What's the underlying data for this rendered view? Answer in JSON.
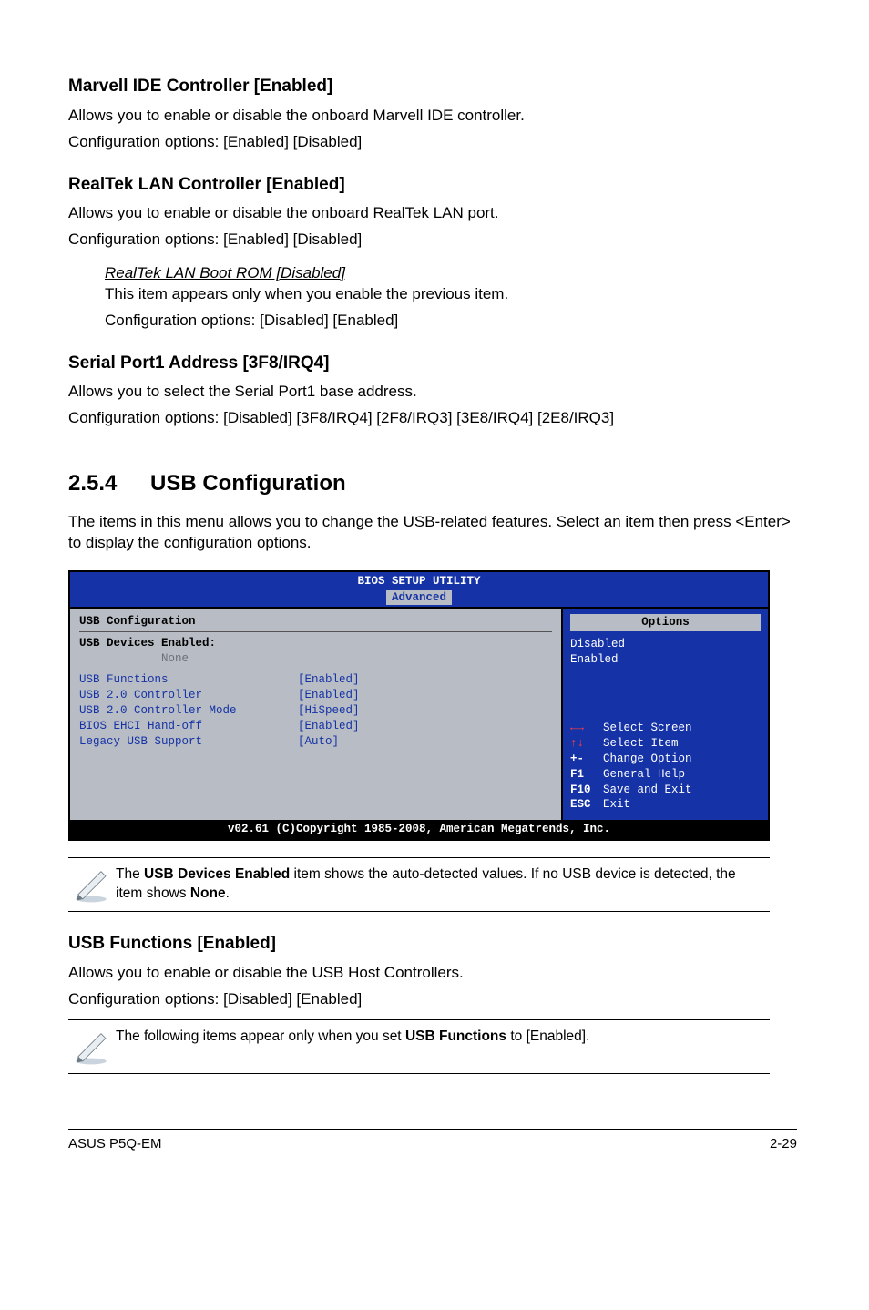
{
  "sec1": {
    "title": "Marvell IDE Controller [Enabled]",
    "p1": "Allows you to enable or disable the onboard Marvell IDE controller.",
    "p2": "Configuration options: [Enabled] [Disabled]"
  },
  "sec2": {
    "title": "RealTek LAN Controller [Enabled]",
    "p1": "Allows you to enable or disable the onboard RealTek LAN port.",
    "p2": "Configuration options: [Enabled] [Disabled]",
    "sub": {
      "title": "RealTek LAN Boot ROM [Disabled]",
      "p1": "This item appears only when you enable the previous item.",
      "p2": "Configuration options: [Disabled] [Enabled]"
    }
  },
  "sec3": {
    "title": "Serial Port1 Address [3F8/IRQ4]",
    "p1": "Allows you to select the Serial Port1 base address.",
    "p2": "Configuration options: [Disabled] [3F8/IRQ4] [2F8/IRQ3] [3E8/IRQ4] [2E8/IRQ3]"
  },
  "sec4": {
    "num": "2.5.4",
    "title": "USB Configuration",
    "p1": "The items in this menu allows you to change the USB-related features. Select an item then press <Enter> to display the configuration options."
  },
  "bios": {
    "toptitle": "BIOS SETUP UTILITY",
    "tab": "Advanced",
    "cfg_title": "USB Configuration",
    "dev_title": "USB Devices Enabled:",
    "dev_none": "None",
    "rows": [
      {
        "label": "USB Functions",
        "value": "[Enabled]"
      },
      {
        "label": "USB 2.0 Controller",
        "value": "[Enabled]"
      },
      {
        "label": "USB 2.0 Controller Mode",
        "value": "[HiSpeed]"
      },
      {
        "label": "BIOS EHCI Hand-off",
        "value": "[Enabled]"
      },
      {
        "label": "Legacy USB Support",
        "value": "[Auto]"
      }
    ],
    "options_label": "Options",
    "options": [
      "Disabled",
      "Enabled"
    ],
    "hints": [
      {
        "key_type": "arrow-lr",
        "text": "Select Screen"
      },
      {
        "key_type": "arrow-ud",
        "text": "Select Item"
      },
      {
        "key": "+-",
        "text": "Change Option"
      },
      {
        "key": "F1",
        "text": "General Help"
      },
      {
        "key": "F10",
        "text": "Save and Exit"
      },
      {
        "key": "ESC",
        "text": "Exit"
      }
    ],
    "footer": "v02.61 (C)Copyright 1985-2008, American Megatrends, Inc."
  },
  "note1": {
    "pre": "The ",
    "bold": "USB Devices Enabled",
    "mid": " item shows the auto-detected values. If no USB device is detected, the item shows ",
    "bold2": "None",
    "post": "."
  },
  "sec5": {
    "title": "USB Functions [Enabled]",
    "p1": "Allows you to enable or disable the USB Host Controllers.",
    "p2": "Configuration options: [Disabled] [Enabled]"
  },
  "note2": {
    "pre": "The following items appear only when you set ",
    "bold": "USB Functions",
    "post": " to [Enabled]."
  },
  "footer": {
    "left": "ASUS P5Q-EM",
    "right": "2-29"
  }
}
